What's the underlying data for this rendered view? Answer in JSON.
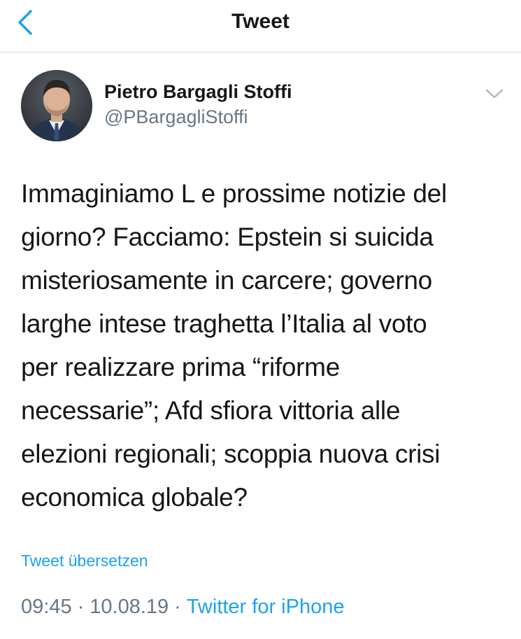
{
  "nav": {
    "title": "Tweet",
    "back_icon": "chevron-left-icon"
  },
  "author": {
    "display_name": "Pietro Bargagli Stoffi",
    "handle": "@PBargagliStoffi",
    "caret_icon": "chevron-down-icon"
  },
  "tweet": {
    "lines": [
      "Immaginiamo L e prossime notizie del",
      "giorno? Facciamo: Epstein si suicida",
      "misteriosamente in carcere; governo",
      "larghe intese traghetta l’Italia al voto",
      "per realizzare prima “riforme",
      "necessarie”; Afd sfiora vittoria alle",
      "elezioni regionali; scoppia nuova crisi",
      "economica globale?"
    ],
    "translate_label": "Tweet übersetzen"
  },
  "meta": {
    "time": "09:45",
    "separator": "·",
    "date": "10.08.19",
    "source": "Twitter for iPhone"
  },
  "colors": {
    "accent": "#1da1f2",
    "muted": "#657786",
    "text": "#14171a",
    "divider": "#d8dde2"
  }
}
